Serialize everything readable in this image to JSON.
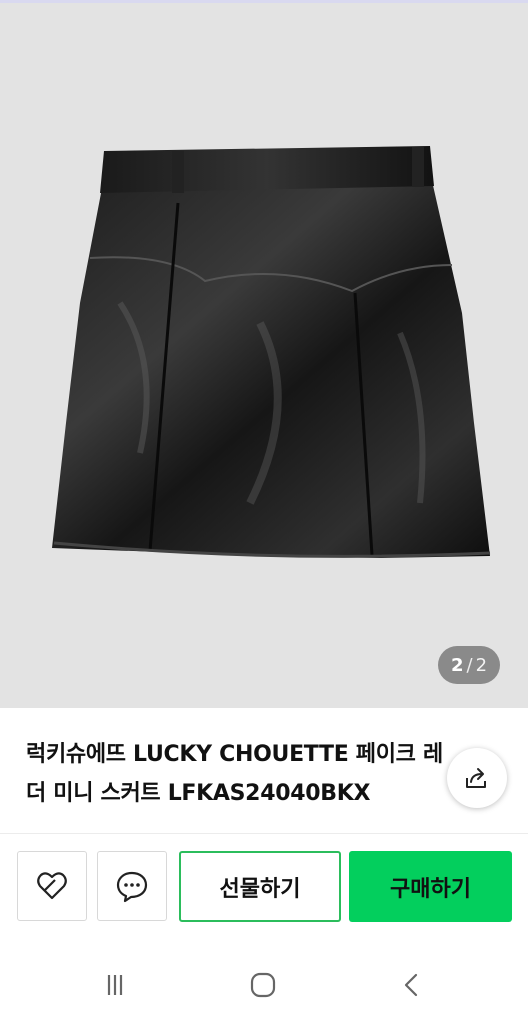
{
  "gallery": {
    "current": "2",
    "separator": "/",
    "total": "2",
    "image_alt": "black faux leather mini skirt"
  },
  "product": {
    "title": "럭키슈에뜨 LUCKY CHOUETTE 페이크 레더 미니 스커트 LFKAS24040BKX"
  },
  "actions": {
    "gift_label": "선물하기",
    "buy_label": "구매하기"
  },
  "colors": {
    "buy_bg": "#03cf5d",
    "gift_border": "#2bbd5c",
    "image_bg": "#e3e3e3",
    "counter_bg": "#8a8a8a"
  },
  "icons": {
    "share": "share-icon",
    "like": "heart-icon",
    "chat": "chat-icon",
    "recent": "recent-apps-icon",
    "home": "home-icon",
    "back": "back-icon"
  }
}
